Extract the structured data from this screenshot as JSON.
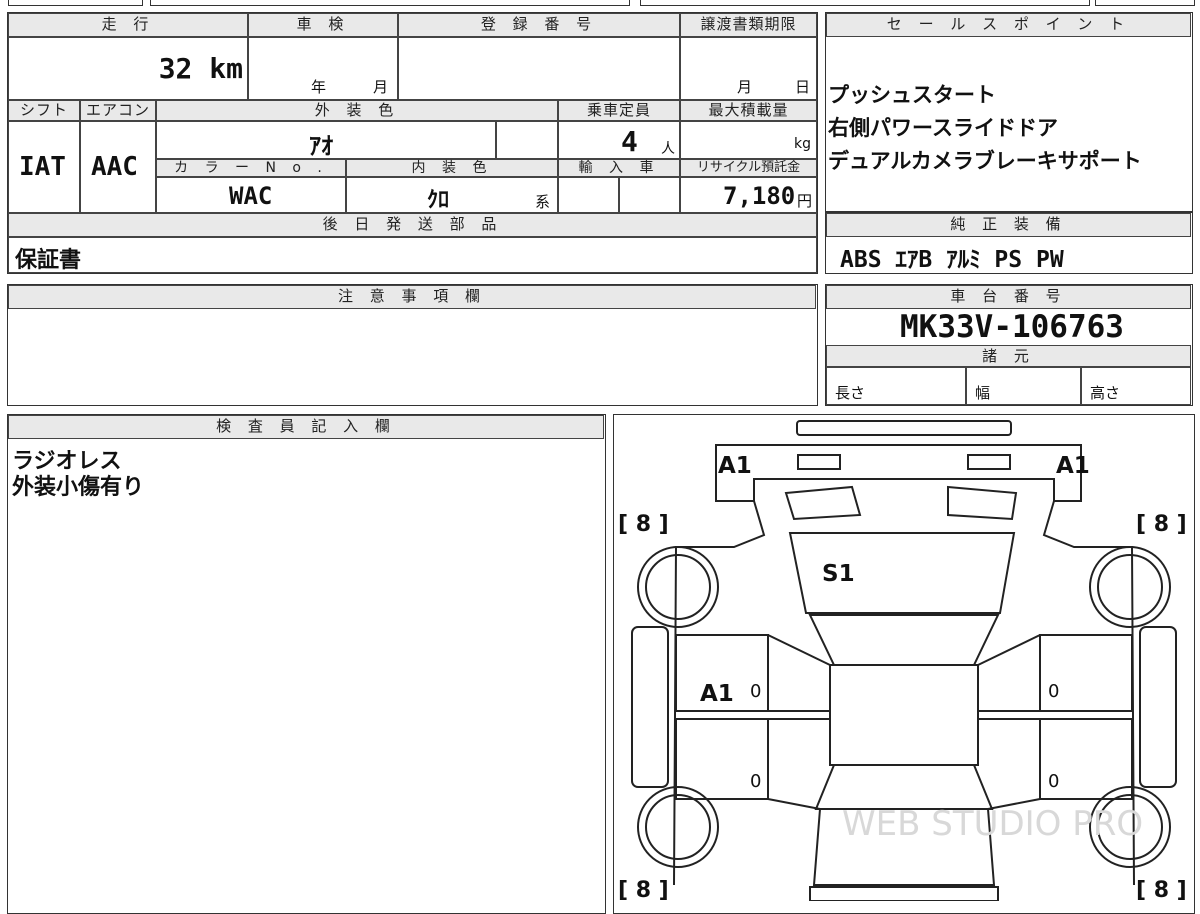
{
  "top_left": {
    "headers": {
      "mileage": "走 行",
      "inspection": "車 検",
      "registration_no": "登 録 番 号",
      "transfer_deadline": "譲渡書類期限"
    },
    "mileage_value": "32 km",
    "inspection_year": "年",
    "inspection_month": "月",
    "deadline_month": "月",
    "deadline_day": "日",
    "row2_headers": {
      "shift": "シフト",
      "aircon": "エアコン",
      "exterior_color": "外 装 色",
      "capacity": "乗車定員",
      "max_load": "最大積載量"
    },
    "shift_value": "IAT",
    "aircon_value": "AAC",
    "exterior_color_value": "ｱｵ",
    "capacity_value": "4",
    "capacity_unit": "人",
    "max_load_unit": "kg",
    "row3_headers": {
      "color_no": "カ ラ ー N o .",
      "interior_color": "内 装 色",
      "import": "輸 入 車",
      "recycle": "リサイクル預託金"
    },
    "color_no_value": "WAC",
    "interior_color_value": "ｸﾛ",
    "interior_suffix": "系",
    "recycle_value": "7,180",
    "recycle_unit": "円",
    "later_parts_header": "後 日 発 送 部 品",
    "later_parts_value": "保証書"
  },
  "sales_points": {
    "header": "セ ー ル ス ポ イ ン ト",
    "items": [
      "プッシュスタート",
      "右側パワースライドドア",
      "デュアルカメラブレーキサポート"
    ]
  },
  "genuine_equipment": {
    "header": "純 正 装 備",
    "value": "ABS ｴｱB ｱﾙﾐ PS PW"
  },
  "notes": {
    "header": "注 意 事 項 欄",
    "value": ""
  },
  "chassis": {
    "header": "車 台 番 号",
    "value": "MK33V-106763",
    "specs_header": "諸 元",
    "length_label": "長さ",
    "width_label": "幅",
    "height_label": "高さ"
  },
  "inspector": {
    "header": "検 査 員 記 入 欄",
    "lines": [
      "ラジオレス",
      "外装小傷有り"
    ]
  },
  "diagram": {
    "tire_marks": [
      "[ 8 ]",
      "[ 8 ]",
      "[ 8 ]",
      "[ 8 ]"
    ],
    "damage_marks": [
      "A1",
      "A1",
      "S1",
      "A1"
    ],
    "door_marks": [
      "0",
      "0",
      "0",
      "0"
    ],
    "watermark": "WEB STUDIO PRO"
  }
}
